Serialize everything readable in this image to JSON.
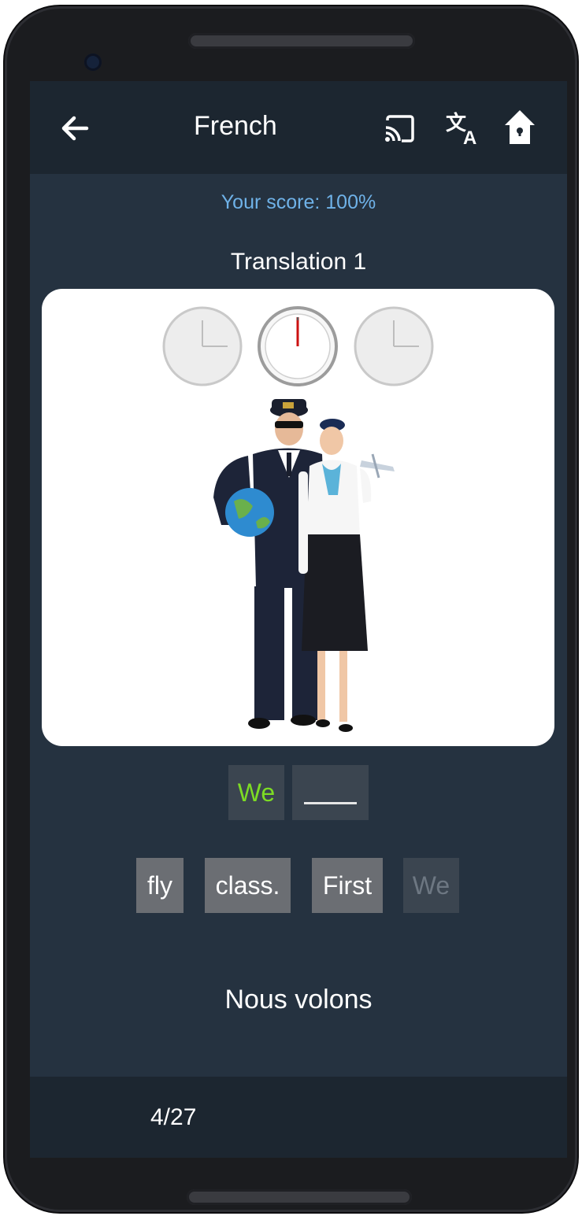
{
  "header": {
    "title": "French",
    "back_icon": "arrow-left-icon",
    "cast_icon": "cast-icon",
    "translate_icon": "translate-icon",
    "home_icon": "home-icon"
  },
  "score": {
    "text": "Your score: 100%"
  },
  "exercise": {
    "title": "Translation 1",
    "image_description_icon": "pilot-and-flight-attendant-image"
  },
  "answer": {
    "filled": "We",
    "blank": ""
  },
  "choices": [
    {
      "label": "fly"
    },
    {
      "label": "class."
    },
    {
      "label": "First"
    },
    {
      "label": "We"
    }
  ],
  "source_sentence": "Nous volons",
  "footer": {
    "progress": "4/27"
  },
  "colors": {
    "appbar": "#1c2630",
    "screen": "#253240",
    "score": "#6fb2e8",
    "correct": "#7ddc24",
    "chip": "#6b6e73",
    "slot": "#3b4550"
  }
}
